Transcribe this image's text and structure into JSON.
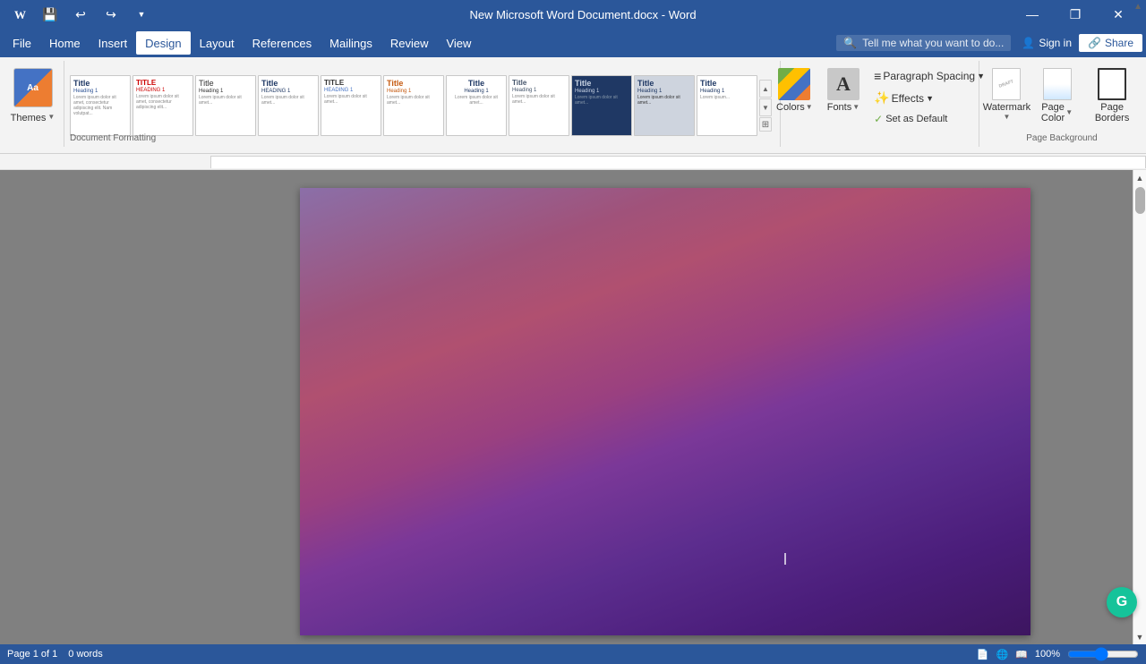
{
  "titlebar": {
    "title": "New Microsoft Word Document.docx - Word",
    "save_icon": "💾",
    "undo_icon": "↩",
    "redo_icon": "↪",
    "minimize": "—",
    "restore": "❐",
    "close": "✕"
  },
  "menubar": {
    "items": [
      "File",
      "Home",
      "Insert",
      "Design",
      "Layout",
      "References",
      "Mailings",
      "Review",
      "View"
    ],
    "active": "Design",
    "search_placeholder": "Tell me what you want to do...",
    "signin": "Sign in",
    "share": "Share"
  },
  "ribbon": {
    "themes_label": "Themes",
    "themes_arrow": "▼",
    "formatting_label": "Document Formatting",
    "styles": [
      {
        "title": "Title",
        "heading": "Heading 1",
        "id": "default"
      },
      {
        "title": "TITLE",
        "heading": "HEADING 1",
        "id": "distinctive"
      },
      {
        "title": "Title",
        "heading": "Heading 1",
        "id": "minimalist"
      },
      {
        "title": "Title",
        "heading": "HEADING 1",
        "id": "basic-a"
      },
      {
        "title": "TITLE",
        "heading": "HEADING 1",
        "id": "basic-b"
      },
      {
        "title": "Title",
        "heading": "Heading 1",
        "id": "casual"
      },
      {
        "title": "Title",
        "heading": "Heading 1",
        "id": "centered"
      },
      {
        "title": "Title",
        "heading": "Heading 1",
        "id": "compact"
      },
      {
        "title": "Title",
        "heading": "Heading 1",
        "id": "ion-dark"
      },
      {
        "title": "Title",
        "heading": "Heading 1",
        "id": "ion-light"
      },
      {
        "title": "Title",
        "heading": "Heading 1",
        "id": "linesandmore"
      }
    ],
    "colors_label": "Colors",
    "fonts_label": "Fonts",
    "paragraph_spacing_label": "Paragraph Spacing",
    "effects_label": "Effects",
    "set_default_label": "Set as Default",
    "watermark_label": "Watermark",
    "page_color_label": "Page Color",
    "page_borders_label": "Page Borders",
    "page_background_label": "Page Background"
  },
  "status": {
    "page_info": "Page 1 of 1",
    "word_count": "0 words"
  }
}
